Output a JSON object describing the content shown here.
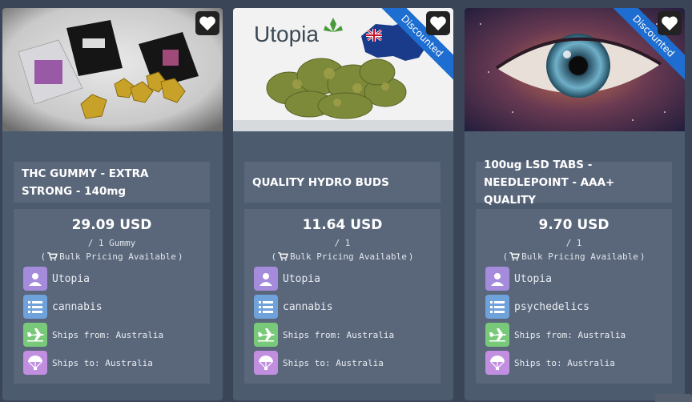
{
  "listings": [
    {
      "title": "THC GUMMY - EXTRA STRONG - 140mg",
      "price": "29.09 USD",
      "unit": "/ 1 Gummy",
      "bulk": "Bulk Pricing Available",
      "vendor": "Utopia",
      "category": "cannabis",
      "ships_from": "Ships from: Australia",
      "ships_to": "Ships to: Australia",
      "badge": "",
      "image_label": "",
      "icons": [
        "heart-icon",
        "user-icon",
        "list-icon",
        "plane-icon",
        "parachute-icon",
        "cart-icon"
      ]
    },
    {
      "title": "QUALITY HYDRO BUDS",
      "price": "11.64 USD",
      "unit": "/ 1",
      "bulk": "Bulk Pricing Available",
      "vendor": "Utopia",
      "category": "cannabis",
      "ships_from": "Ships from: Australia",
      "ships_to": "Ships to: Australia",
      "badge": "Discounted",
      "image_label": "Utopia"
    },
    {
      "title": "100ug LSD TABS - NEEDLEPOINT - AAA+ QUALITY",
      "price": "9.70 USD",
      "unit": "/ 1",
      "bulk": "Bulk Pricing Available",
      "vendor": "Utopia",
      "category": "psychedelics",
      "ships_from": "Ships from: Australia",
      "ships_to": "Ships to: Australia",
      "badge": "Discounted",
      "image_label": ""
    }
  ],
  "colors": {
    "page_bg": "#3a4658",
    "card_bg": "#4d5b6f",
    "panel_bg": "#5a677b",
    "ribbon": "#1e6ed1",
    "vendor_icon": "#a58bdc",
    "category_icon": "#6fa2db",
    "ships_from_icon": "#79c97a",
    "ships_to_icon": "#c18ee0"
  }
}
